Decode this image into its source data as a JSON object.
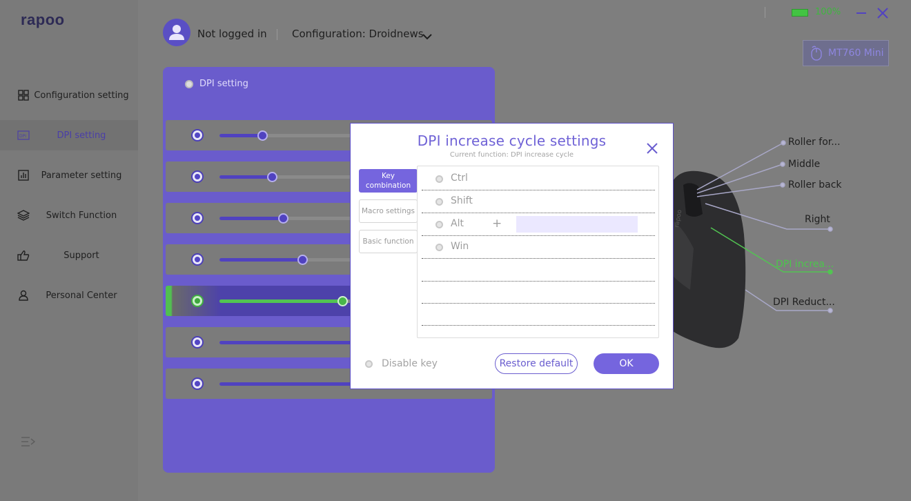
{
  "app": {
    "logo": "rapoo"
  },
  "sidebar": {
    "items": [
      {
        "label": "Configuration setting",
        "icon": "grid-icon"
      },
      {
        "label": "DPI setting",
        "icon": "dpi-icon",
        "active": true
      },
      {
        "label": "Parameter setting",
        "icon": "bar-chart-icon"
      },
      {
        "label": "Switch Function",
        "icon": "layers-icon"
      },
      {
        "label": "Support",
        "icon": "thumbs-up-icon"
      },
      {
        "label": "Personal Center",
        "icon": "user-icon"
      }
    ]
  },
  "header": {
    "login_status": "Not logged in",
    "configuration": "Configuration: Droidnews",
    "battery": "100%",
    "device": "MT760 Mini"
  },
  "dpi_panel": {
    "title": "DPI setting",
    "levels": [
      0.31,
      0.38,
      0.46,
      0.6,
      0.89,
      1.0,
      1.0
    ],
    "active_index": 4
  },
  "mouse_callouts": [
    {
      "label": "Roller for..."
    },
    {
      "label": "Middle"
    },
    {
      "label": "Roller back"
    },
    {
      "label": "Right"
    },
    {
      "label": "DPI increa...",
      "highlight": true
    },
    {
      "label": "DPI Reduct..."
    }
  ],
  "modal": {
    "title": "DPI increase cycle settings",
    "subtitle": "Current function: DPI increase cycle",
    "tabs": [
      "Key combination",
      "Macro settings",
      "Basic function"
    ],
    "keys": [
      "Ctrl",
      "Shift",
      "Alt",
      "Win"
    ],
    "plus": "+",
    "disable_key": "Disable key",
    "restore_button": "Restore default",
    "ok_button": "OK"
  },
  "colors": {
    "accent": "#6a5ccc",
    "active_green": "#52c452",
    "title": "#6f62d6"
  }
}
